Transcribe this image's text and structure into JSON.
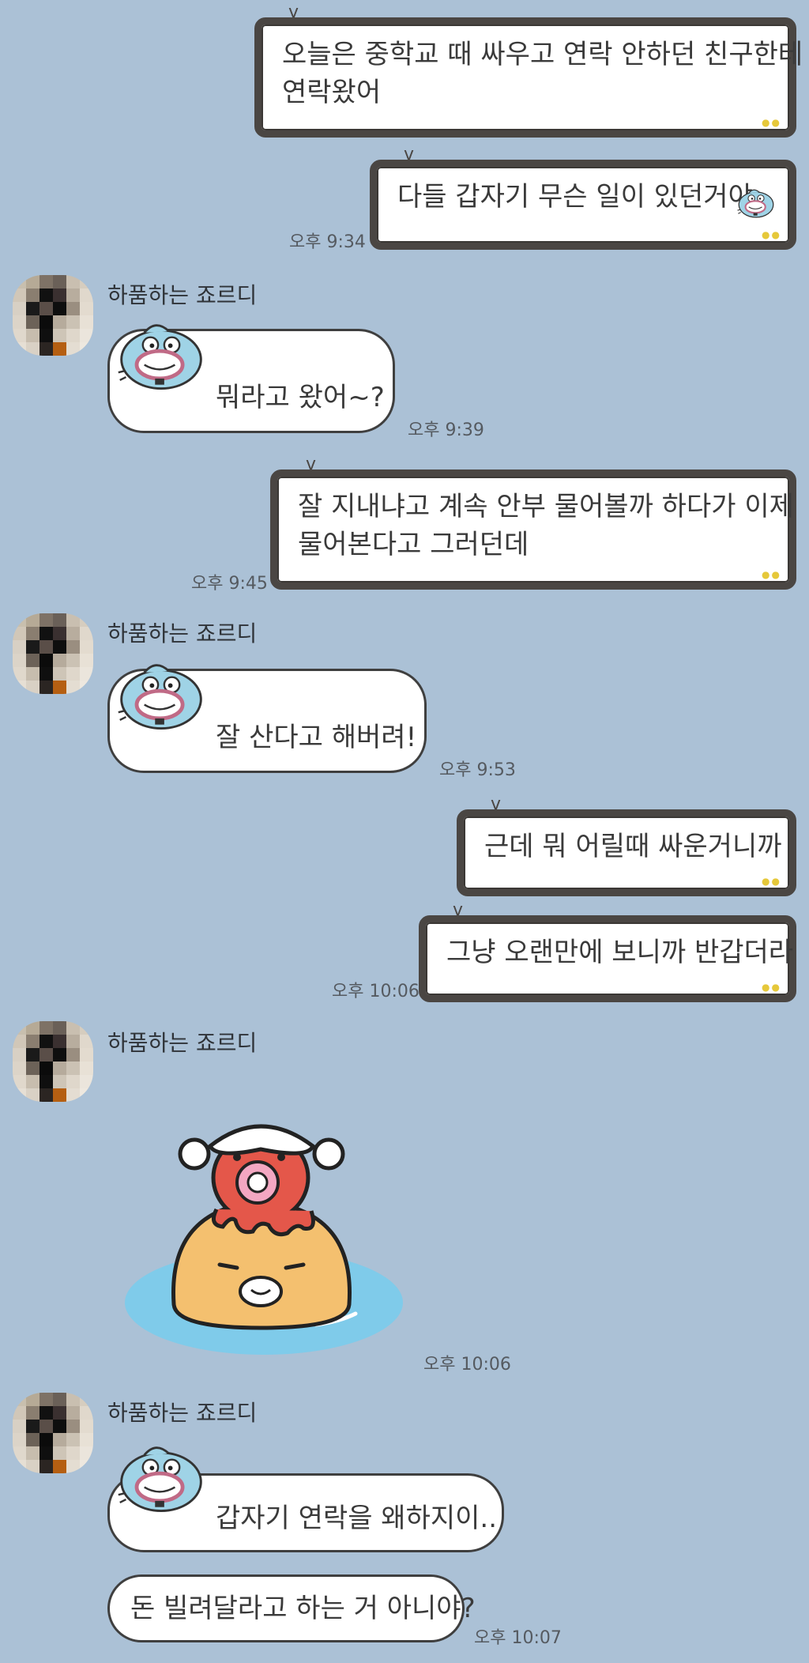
{
  "contact": {
    "name": "하품하는 죠르디"
  },
  "colors": {
    "background": "#abc1d6",
    "sent_frame": "#4a4643",
    "bubble": "#ffffff",
    "frame_dots": "#e6c83a"
  },
  "messages": [
    {
      "id": "m1",
      "from": "me",
      "lines": [
        "오늘은 중학교 때 싸우고 연락 안하던 친구한테",
        "연락왔어"
      ]
    },
    {
      "id": "m2",
      "from": "me",
      "lines": [
        "다들 갑자기 무슨 일이 있던거야"
      ],
      "time": "오후 9:34",
      "has_emoji": true
    },
    {
      "id": "m3",
      "from": "other",
      "lines": [
        "뭐라고 왔어~?"
      ],
      "time": "오후 9:39",
      "has_mascot": true
    },
    {
      "id": "m4",
      "from": "me",
      "lines": [
        "잘 지내냐고 계속 안부 물어볼까 하다가 이제",
        "물어본다고 그러던데"
      ],
      "time": "오후 9:45"
    },
    {
      "id": "m5",
      "from": "other",
      "lines": [
        "잘 산다고 해버려!"
      ],
      "time": "오후 9:53",
      "has_mascot": true
    },
    {
      "id": "m6",
      "from": "me",
      "lines": [
        "근데 뭐 어릴때 싸운거니까"
      ]
    },
    {
      "id": "m7",
      "from": "me",
      "lines": [
        "그냥 오랜만에 보니까 반갑더라"
      ],
      "time": "오후 10:06"
    },
    {
      "id": "m8",
      "from": "other",
      "sticker": "octopus-on-jordy-sticker",
      "time": "오후 10:06"
    },
    {
      "id": "m9",
      "from": "other",
      "lines": [
        "갑자기 연락을 왜하지이.."
      ],
      "has_mascot": true
    },
    {
      "id": "m10",
      "from": "other",
      "lines": [
        "돈 빌려달라고 하는 거 아니야?"
      ],
      "time": "오후 10:07"
    }
  ]
}
